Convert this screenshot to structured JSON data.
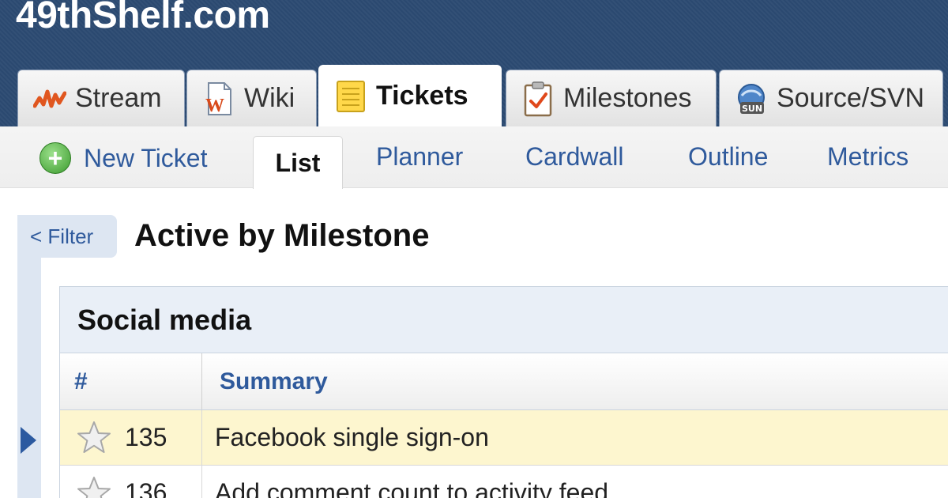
{
  "site": {
    "title": "49thShelf.com"
  },
  "main_tabs": [
    {
      "label": "Stream",
      "icon": "stream-icon",
      "active": false
    },
    {
      "label": "Wiki",
      "icon": "wiki-document-icon",
      "active": false
    },
    {
      "label": "Tickets",
      "icon": "tickets-notepad-icon",
      "active": true
    },
    {
      "label": "Milestones",
      "icon": "milestones-clipboard-check-icon",
      "active": false
    },
    {
      "label": "Source/SVN",
      "icon": "source-svn-icon",
      "active": false
    }
  ],
  "sub_nav": {
    "new_ticket": "New Ticket",
    "list": "List",
    "planner": "Planner",
    "cardwall": "Cardwall",
    "outline": "Outline",
    "metrics": "Metrics"
  },
  "filter_label": "< Filter",
  "page_title": "Active by Milestone",
  "milestone_group": {
    "name": "Social media",
    "columns": {
      "number": "#",
      "summary": "Summary"
    },
    "rows": [
      {
        "number": "135",
        "summary": "Facebook single sign-on",
        "selected": true
      },
      {
        "number": "136",
        "summary": "Add comment count to activity feed",
        "selected": false
      }
    ]
  },
  "colors": {
    "header_bg": "#2c4a72",
    "link_blue": "#2f5a9c",
    "selected_row": "#fdf6cf",
    "group_header": "#e9eff7"
  }
}
